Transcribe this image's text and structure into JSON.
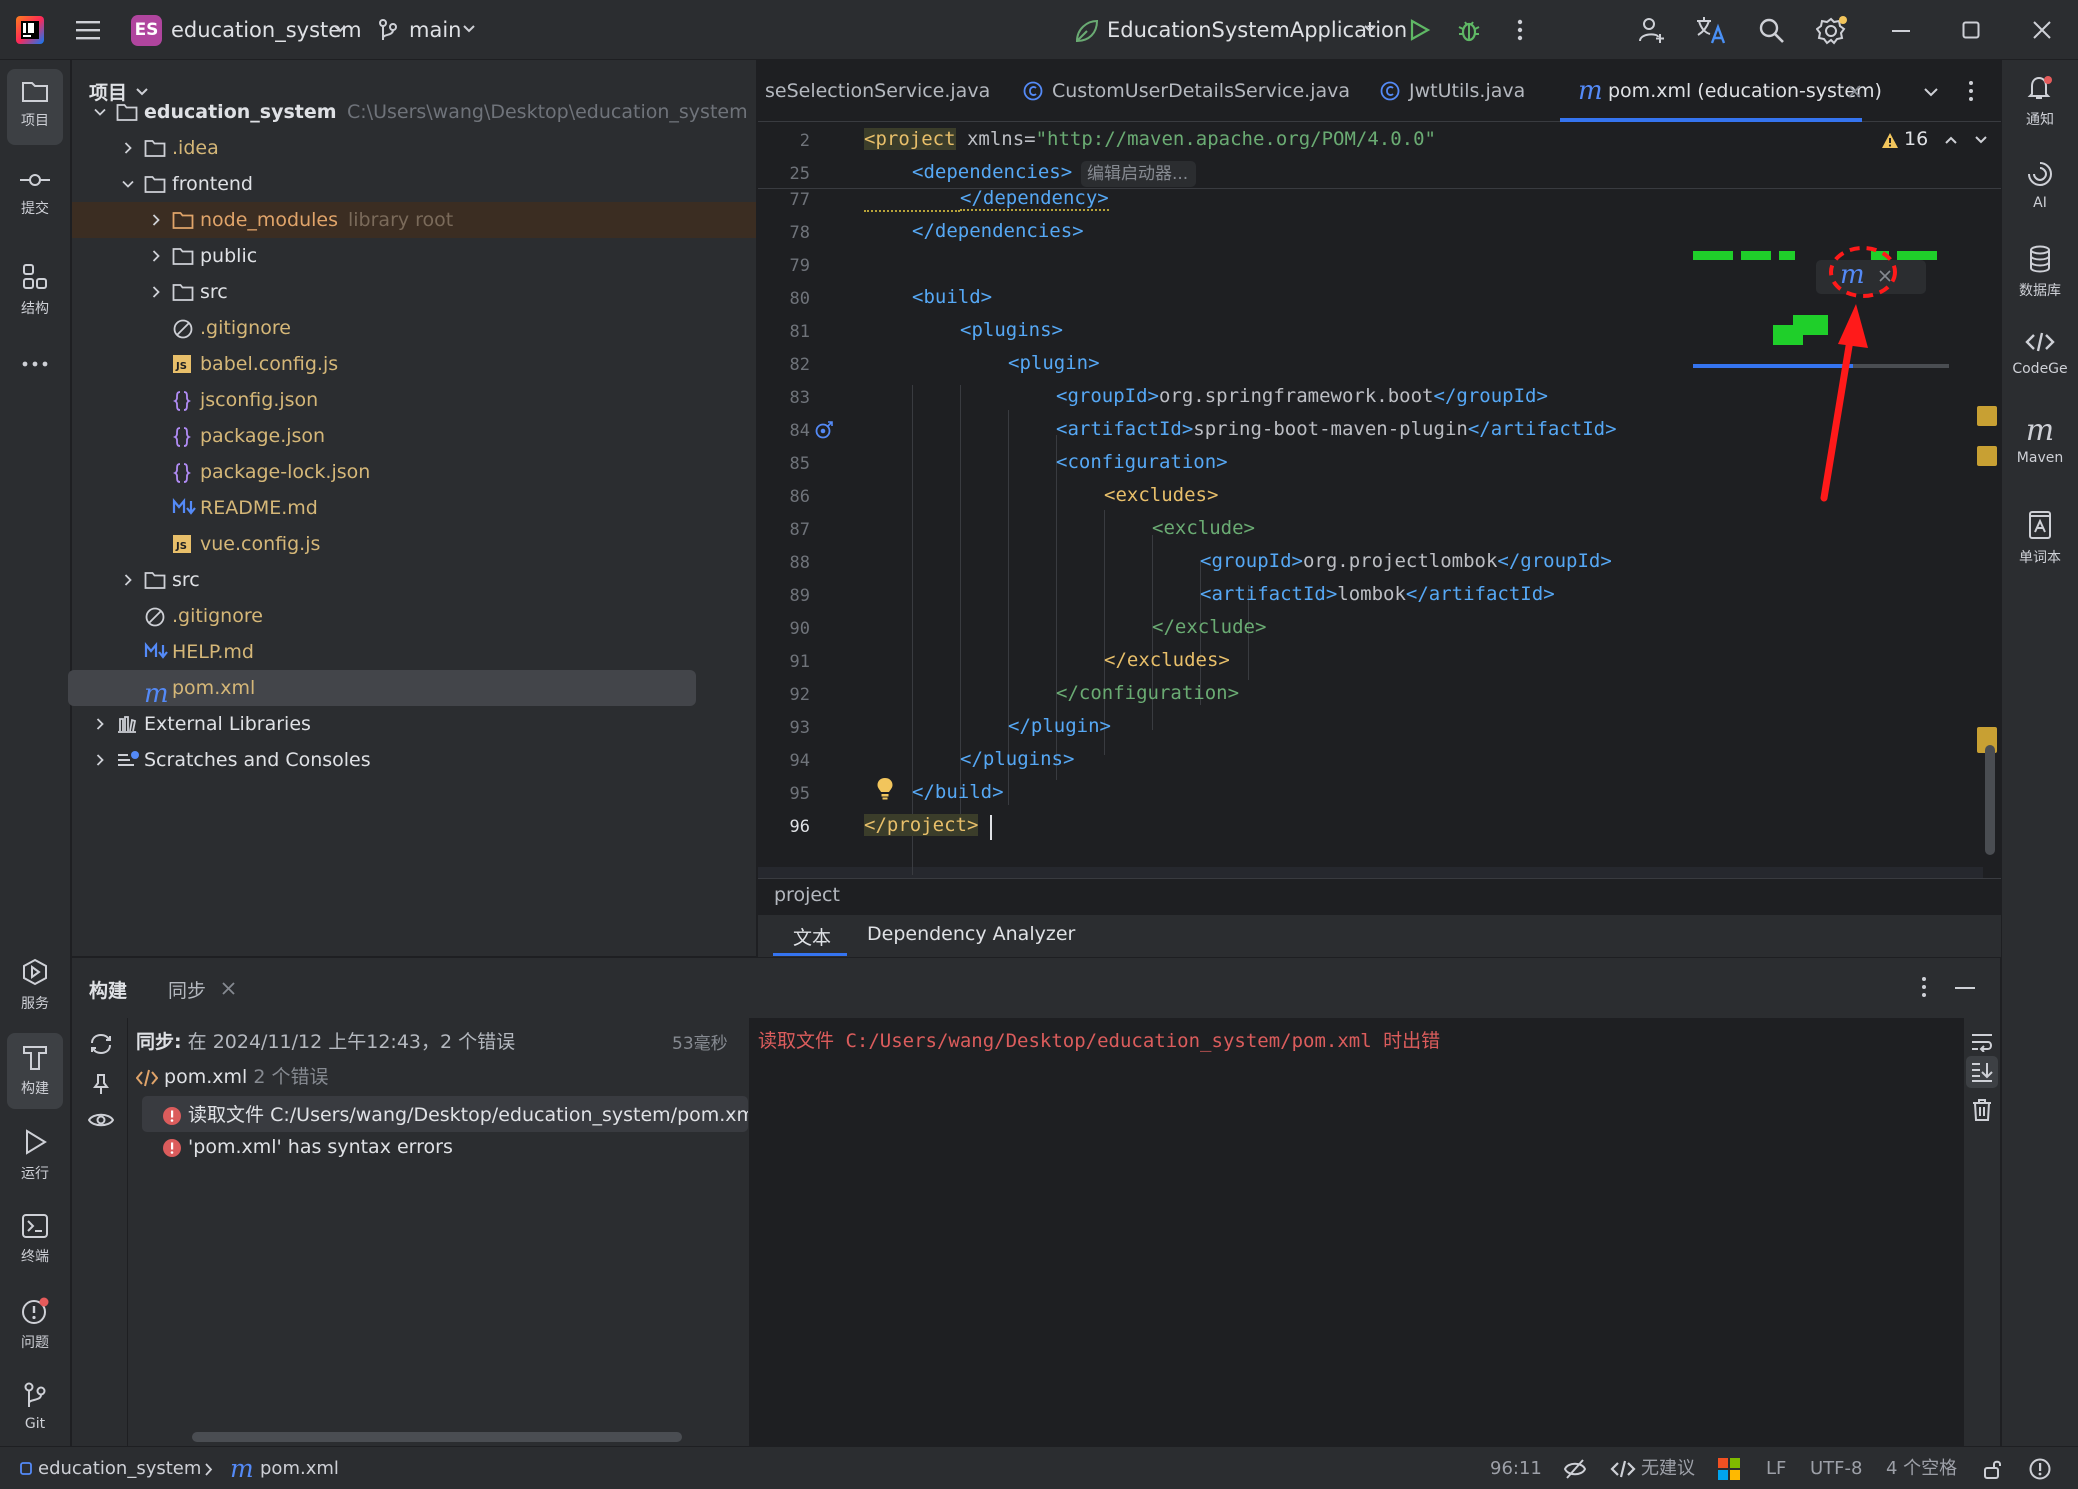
{
  "titlebar": {
    "project_badge": "ES",
    "project_name": "education_system",
    "branch": "main",
    "run_config": "EducationSystemApplication"
  },
  "left_tools": [
    {
      "label": "项目",
      "icon": "folder-icon"
    },
    {
      "label": "提交",
      "icon": "commit-icon"
    },
    {
      "label": "结构",
      "icon": "structure-icon"
    },
    {
      "label": "服务",
      "icon": "services-icon"
    },
    {
      "label": "构建",
      "icon": "hammer-icon"
    },
    {
      "label": "运行",
      "icon": "run-icon"
    },
    {
      "label": "终端",
      "icon": "terminal-icon"
    },
    {
      "label": "问题",
      "icon": "problems-icon"
    },
    {
      "label": "Git",
      "icon": "git-icon"
    }
  ],
  "right_tools": [
    {
      "label": "通知",
      "icon": "bell-icon"
    },
    {
      "label": "AI",
      "icon": "ai-icon"
    },
    {
      "label": "数据库",
      "icon": "database-icon"
    },
    {
      "label": "CodeGe",
      "icon": "codegeex-icon"
    },
    {
      "label": "Maven",
      "icon": "maven-icon"
    },
    {
      "label": "单词本",
      "icon": "wordbook-icon"
    }
  ],
  "project_panel": {
    "title": "项目",
    "tree": [
      {
        "name": "education_system",
        "hint": "C:\\Users\\wang\\Desktop\\education_system",
        "kind": "folder",
        "color": "#dfe1e5"
      },
      {
        "name": ".idea",
        "hint": "",
        "kind": "folder",
        "color": "#d5b778"
      },
      {
        "name": "frontend",
        "hint": "",
        "kind": "folder",
        "color": "#dfe1e5"
      },
      {
        "name": "node_modules",
        "hint": "library root",
        "kind": "folder",
        "color": "#e0a46a"
      },
      {
        "name": "public",
        "hint": "",
        "kind": "folder",
        "color": "#dfe1e5"
      },
      {
        "name": "src",
        "hint": "",
        "kind": "folder",
        "color": "#dfe1e5"
      },
      {
        "name": ".gitignore",
        "hint": "",
        "kind": "ignore",
        "color": "#d5b778"
      },
      {
        "name": "babel.config.js",
        "hint": "",
        "kind": "js",
        "color": "#d5b778"
      },
      {
        "name": "jsconfig.json",
        "hint": "",
        "kind": "json",
        "color": "#d5b778"
      },
      {
        "name": "package.json",
        "hint": "",
        "kind": "json",
        "color": "#d5b778"
      },
      {
        "name": "package-lock.json",
        "hint": "",
        "kind": "json",
        "color": "#d5b778"
      },
      {
        "name": "README.md",
        "hint": "",
        "kind": "md",
        "color": "#d5b778"
      },
      {
        "name": "vue.config.js",
        "hint": "",
        "kind": "js",
        "color": "#d5b778"
      },
      {
        "name": "src",
        "hint": "",
        "kind": "folder",
        "color": "#dfe1e5"
      },
      {
        "name": ".gitignore",
        "hint": "",
        "kind": "ignore",
        "color": "#d5b778"
      },
      {
        "name": "HELP.md",
        "hint": "",
        "kind": "md",
        "color": "#d5b778"
      },
      {
        "name": "pom.xml",
        "hint": "",
        "kind": "maven",
        "color": "#d5b778"
      },
      {
        "name": "External Libraries",
        "hint": "",
        "kind": "lib",
        "color": "#dfe1e5"
      },
      {
        "name": "Scratches and Consoles",
        "hint": "",
        "kind": "scratch",
        "color": "#dfe1e5"
      }
    ]
  },
  "editor": {
    "tabs": [
      {
        "label": "seSelectionService.java"
      },
      {
        "label": "CustomUserDetailsService.java"
      },
      {
        "label": "JwtUtils.java"
      },
      {
        "label": "pom.xml (education-system)"
      }
    ],
    "warnings_count": "16",
    "sticky": [
      {
        "num": "2",
        "text": "<project xmlns=\"http://maven.apache.org/POM/4.0.0\""
      },
      {
        "num": "25",
        "text": "<dependencies>"
      }
    ],
    "inlay_hint": "编辑启动器...",
    "lines": [
      {
        "num": "77",
        "text": "</dependency>"
      },
      {
        "num": "78",
        "text": "</dependencies>"
      },
      {
        "num": "79",
        "text": ""
      },
      {
        "num": "80",
        "text": "<build>"
      },
      {
        "num": "81",
        "text": "<plugins>"
      },
      {
        "num": "82",
        "text": "<plugin>"
      },
      {
        "num": "83",
        "text": "<groupId>org.springframework.boot</groupId>"
      },
      {
        "num": "84",
        "text": "<artifactId>spring-boot-maven-plugin</artifactId>"
      },
      {
        "num": "85",
        "text": "<configuration>"
      },
      {
        "num": "86",
        "text": "<excludes>"
      },
      {
        "num": "87",
        "text": "<exclude>"
      },
      {
        "num": "88",
        "text": "<groupId>org.projectlombok</groupId>"
      },
      {
        "num": "89",
        "text": "<artifactId>lombok</artifactId>"
      },
      {
        "num": "90",
        "text": "</exclude>"
      },
      {
        "num": "91",
        "text": "</excludes>"
      },
      {
        "num": "92",
        "text": "</configuration>"
      },
      {
        "num": "93",
        "text": "</plugin>"
      },
      {
        "num": "94",
        "text": "</plugins>"
      },
      {
        "num": "95",
        "text": "</build>"
      },
      {
        "num": "96",
        "text": "</project>"
      }
    ],
    "breadcrumb": "project",
    "bottom_tabs": [
      "文本",
      "Dependency Analyzer"
    ]
  },
  "build_panel": {
    "tabs": [
      "构建",
      "同步"
    ],
    "sync_title": "同步:",
    "sync_detail": "在 2024/11/12 上午12:43，2 个错误",
    "sync_time": "53毫秒",
    "file_node": "pom.xml",
    "file_errors": "2 个错误",
    "errors": [
      "读取文件 C:/Users/wang/Desktop/education_system/pom.xml 时出错",
      "'pom.xml' has syntax errors"
    ],
    "console_prefix": "读取文件 ",
    "console_path": "C:/Users/wang/Desktop/education_system/pom.xml",
    "console_suffix": " 时出错"
  },
  "statusbar": {
    "project": "education_system",
    "file": "pom.xml",
    "position": "96:11",
    "suggestion": "无建议",
    "line_sep": "LF",
    "encoding": "UTF-8",
    "indent": "4 个空格"
  },
  "colors": {
    "accent": "#3574f0",
    "error": "#db5c5c",
    "annotation": "#ff1a1a"
  }
}
